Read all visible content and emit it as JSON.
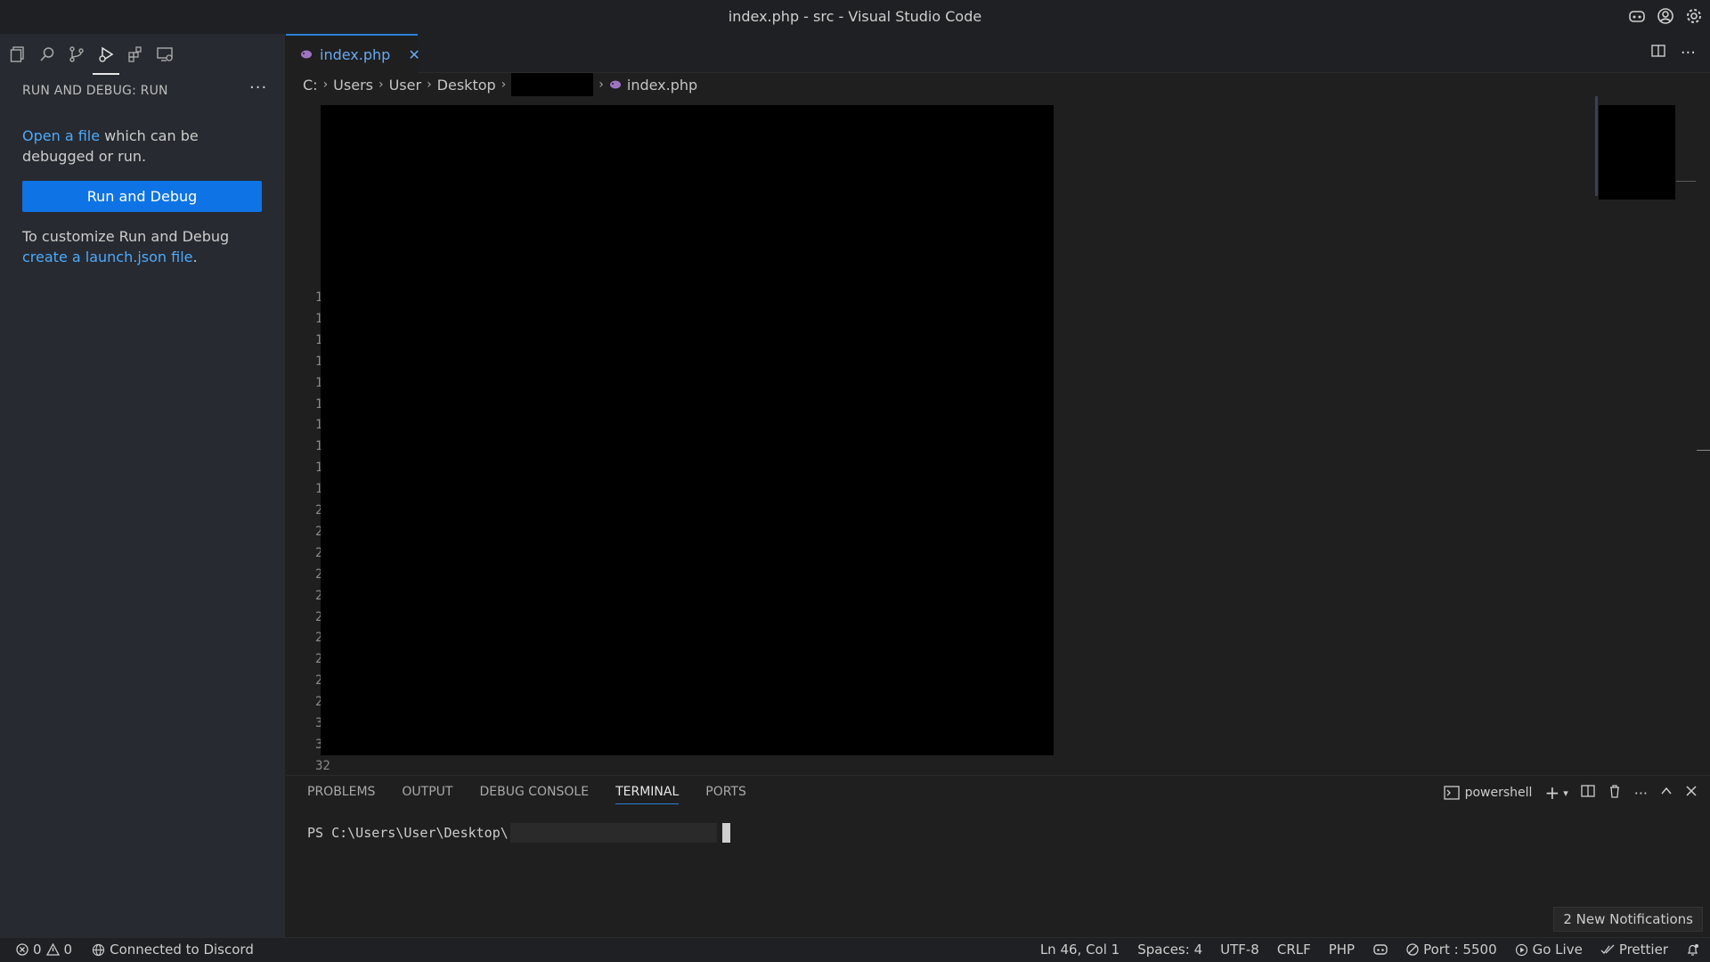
{
  "window": {
    "title": "index.php - src - Visual Studio Code"
  },
  "sidebar": {
    "header": "RUN AND DEBUG: RUN",
    "more": "···",
    "open_file_link": "Open a file",
    "open_file_rest": " which can be debugged or run.",
    "run_button": "Run and Debug",
    "customize_text": "To customize Run and Debug ",
    "launch_link": "create a launch.json file",
    "period": "."
  },
  "tabs": [
    {
      "label": "index.php",
      "close": "✕"
    }
  ],
  "breadcrumb": {
    "items": [
      "C:",
      "Users",
      "User",
      "Desktop",
      "index.php"
    ],
    "sep": "›"
  },
  "editor": {
    "line_numbers": [
      "1",
      "1",
      "1",
      "1",
      "1",
      "1",
      "1",
      "1",
      "1",
      "1",
      "2",
      "2",
      "2",
      "2",
      "2",
      "2",
      "2",
      "2",
      "2",
      "2",
      "3",
      "3",
      "32"
    ]
  },
  "panel": {
    "tabs": [
      "PROBLEMS",
      "OUTPUT",
      "DEBUG CONSOLE",
      "TERMINAL",
      "PORTS"
    ],
    "active_tab": "TERMINAL",
    "shell": "powershell",
    "prompt": "PS C:\\Users\\User\\Desktop\\"
  },
  "notifications": {
    "label": "2 New Notifications"
  },
  "statusbar": {
    "errors": "0",
    "warnings": "0",
    "discord": "Connected to Discord",
    "position": "Ln 46, Col 1",
    "spaces": "Spaces: 4",
    "encoding": "UTF-8",
    "eol": "CRLF",
    "language": "PHP",
    "port": "Port : 5500",
    "golive": "Go Live",
    "prettier": "Prettier"
  },
  "colors": {
    "accent": "#0e73e4",
    "link": "#4daafc",
    "tab_accent": "#2d7fd8"
  }
}
